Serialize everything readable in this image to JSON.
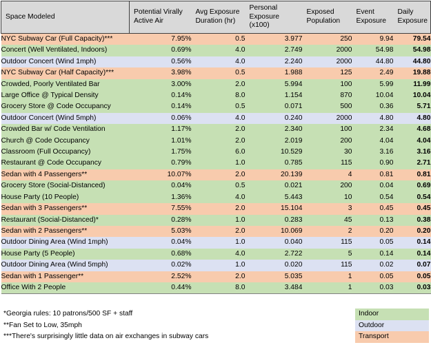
{
  "table": {
    "columns": [
      {
        "key": "space",
        "label": "Space Modeled"
      },
      {
        "key": "pva",
        "label": "Potential Virally Active Air"
      },
      {
        "key": "duration",
        "label": "Avg Exposure Duration (hr)"
      },
      {
        "key": "personal",
        "label": "Personal Exposure (x100)"
      },
      {
        "key": "exposed",
        "label": "Exposed Population"
      },
      {
        "key": "event",
        "label": "Event Exposure"
      },
      {
        "key": "daily",
        "label": "Daily Exposure"
      }
    ],
    "column_labels_multiline": {
      "space": [
        "Space Modeled"
      ],
      "pva": [
        "Potential Virally",
        "Active Air"
      ],
      "duration": [
        "Avg Exposure",
        "Duration (hr)"
      ],
      "personal": [
        "Personal",
        "Exposure",
        "(x100)"
      ],
      "exposed": [
        "Exposed",
        "Population"
      ],
      "event": [
        "Event",
        "Exposure"
      ],
      "daily": [
        "Daily",
        "Exposure"
      ]
    },
    "rows": [
      {
        "space": "NYC Subway Car (Full Capacity)***",
        "pva": "7.95%",
        "duration": "0.5",
        "personal": "3.977",
        "exposed": "250",
        "event": "9.94",
        "daily": "79.54",
        "category": "transport"
      },
      {
        "space": "Concert (Well Ventilated, Indoors)",
        "pva": "0.69%",
        "duration": "4.0",
        "personal": "2.749",
        "exposed": "2000",
        "event": "54.98",
        "daily": "54.98",
        "category": "indoor"
      },
      {
        "space": "Outdoor Concert (Wind 1mph)",
        "pva": "0.56%",
        "duration": "4.0",
        "personal": "2.240",
        "exposed": "2000",
        "event": "44.80",
        "daily": "44.80",
        "category": "outdoor"
      },
      {
        "space": "NYC Subway Car (Half Capacity)***",
        "pva": "3.98%",
        "duration": "0.5",
        "personal": "1.988",
        "exposed": "125",
        "event": "2.49",
        "daily": "19.88",
        "category": "transport"
      },
      {
        "space": "Crowded, Poorly Ventilated Bar",
        "pva": "3.00%",
        "duration": "2.0",
        "personal": "5.994",
        "exposed": "100",
        "event": "5.99",
        "daily": "11.99",
        "category": "indoor"
      },
      {
        "space": "Large Office @ Typical Density",
        "pva": "0.14%",
        "duration": "8.0",
        "personal": "1.154",
        "exposed": "870",
        "event": "10.04",
        "daily": "10.04",
        "category": "indoor"
      },
      {
        "space": "Grocery Store @ Code Occupancy",
        "pva": "0.14%",
        "duration": "0.5",
        "personal": "0.071",
        "exposed": "500",
        "event": "0.36",
        "daily": "5.71",
        "category": "indoor"
      },
      {
        "space": "Outdoor Concert (Wind 5mph)",
        "pva": "0.06%",
        "duration": "4.0",
        "personal": "0.240",
        "exposed": "2000",
        "event": "4.80",
        "daily": "4.80",
        "category": "outdoor"
      },
      {
        "space": "Crowded Bar w/ Code Ventilation",
        "pva": "1.17%",
        "duration": "2.0",
        "personal": "2.340",
        "exposed": "100",
        "event": "2.34",
        "daily": "4.68",
        "category": "indoor"
      },
      {
        "space": "Church @ Code Occupancy",
        "pva": "1.01%",
        "duration": "2.0",
        "personal": "2.019",
        "exposed": "200",
        "event": "4.04",
        "daily": "4.04",
        "category": "indoor"
      },
      {
        "space": "Classroom (Full Occupancy)",
        "pva": "1.75%",
        "duration": "6.0",
        "personal": "10.529",
        "exposed": "30",
        "event": "3.16",
        "daily": "3.16",
        "category": "indoor"
      },
      {
        "space": "Restaurant @ Code Occupancy",
        "pva": "0.79%",
        "duration": "1.0",
        "personal": "0.785",
        "exposed": "115",
        "event": "0.90",
        "daily": "2.71",
        "category": "indoor"
      },
      {
        "space": "Sedan with 4 Passengers**",
        "pva": "10.07%",
        "duration": "2.0",
        "personal": "20.139",
        "exposed": "4",
        "event": "0.81",
        "daily": "0.81",
        "category": "transport"
      },
      {
        "space": "Grocery Store (Social-Distanced)",
        "pva": "0.04%",
        "duration": "0.5",
        "personal": "0.021",
        "exposed": "200",
        "event": "0.04",
        "daily": "0.69",
        "category": "indoor"
      },
      {
        "space": "House Party (10 People)",
        "pva": "1.36%",
        "duration": "4.0",
        "personal": "5.443",
        "exposed": "10",
        "event": "0.54",
        "daily": "0.54",
        "category": "indoor"
      },
      {
        "space": "Sedan with 3 Passengers**",
        "pva": "7.55%",
        "duration": "2.0",
        "personal": "15.104",
        "exposed": "3",
        "event": "0.45",
        "daily": "0.45",
        "category": "transport"
      },
      {
        "space": "Restaurant (Social-Distanced)*",
        "pva": "0.28%",
        "duration": "1.0",
        "personal": "0.283",
        "exposed": "45",
        "event": "0.13",
        "daily": "0.38",
        "category": "indoor"
      },
      {
        "space": "Sedan with 2 Passengers**",
        "pva": "5.03%",
        "duration": "2.0",
        "personal": "10.069",
        "exposed": "2",
        "event": "0.20",
        "daily": "0.20",
        "category": "transport"
      },
      {
        "space": "Outdoor Dining Area (Wind 1mph)",
        "pva": "0.04%",
        "duration": "1.0",
        "personal": "0.040",
        "exposed": "115",
        "event": "0.05",
        "daily": "0.14",
        "category": "outdoor"
      },
      {
        "space": "House Party (5 People)",
        "pva": "0.68%",
        "duration": "4.0",
        "personal": "2.722",
        "exposed": "5",
        "event": "0.14",
        "daily": "0.14",
        "category": "indoor"
      },
      {
        "space": "Outdoor Dining Area (Wind 5mph)",
        "pva": "0.02%",
        "duration": "1.0",
        "personal": "0.020",
        "exposed": "115",
        "event": "0.02",
        "daily": "0.07",
        "category": "outdoor"
      },
      {
        "space": "Sedan with 1 Passenger**",
        "pva": "2.52%",
        "duration": "2.0",
        "personal": "5.035",
        "exposed": "1",
        "event": "0.05",
        "daily": "0.05",
        "category": "transport"
      },
      {
        "space": "Office With 2 People",
        "pva": "0.44%",
        "duration": "8.0",
        "personal": "3.484",
        "exposed": "1",
        "event": "0.03",
        "daily": "0.03",
        "category": "indoor"
      }
    ]
  },
  "footnotes": [
    "*Georgia rules: 10 patrons/500 SF + staff",
    "**Fan Set to Low, 35mph",
    "***There's surprisingly little data on air exchanges in subway cars"
  ],
  "legend": [
    {
      "label": "Indoor",
      "color": "#c6e0b4",
      "category": "indoor"
    },
    {
      "label": "Outdoor",
      "color": "#dce1f2",
      "category": "outdoor"
    },
    {
      "label": "Transport",
      "color": "#f8cbad",
      "category": "transport"
    }
  ],
  "chart_data": {
    "type": "table",
    "title": "Space Modeled exposure comparison",
    "columns": [
      "Space Modeled",
      "Potential Virally Active Air",
      "Avg Exposure Duration (hr)",
      "Personal Exposure (x100)",
      "Exposed Population",
      "Event Exposure",
      "Daily Exposure"
    ],
    "rows": [
      [
        "NYC Subway Car (Full Capacity)***",
        "7.95%",
        0.5,
        3.977,
        250,
        9.94,
        79.54
      ],
      [
        "Concert (Well Ventilated, Indoors)",
        "0.69%",
        4.0,
        2.749,
        2000,
        54.98,
        54.98
      ],
      [
        "Outdoor Concert (Wind 1mph)",
        "0.56%",
        4.0,
        2.24,
        2000,
        44.8,
        44.8
      ],
      [
        "NYC Subway Car (Half Capacity)***",
        "3.98%",
        0.5,
        1.988,
        125,
        2.49,
        19.88
      ],
      [
        "Crowded, Poorly Ventilated Bar",
        "3.00%",
        2.0,
        5.994,
        100,
        5.99,
        11.99
      ],
      [
        "Large Office @ Typical Density",
        "0.14%",
        8.0,
        1.154,
        870,
        10.04,
        10.04
      ],
      [
        "Grocery Store @ Code Occupancy",
        "0.14%",
        0.5,
        0.071,
        500,
        0.36,
        5.71
      ],
      [
        "Outdoor Concert (Wind 5mph)",
        "0.06%",
        4.0,
        0.24,
        2000,
        4.8,
        4.8
      ],
      [
        "Crowded Bar w/ Code Ventilation",
        "1.17%",
        2.0,
        2.34,
        100,
        2.34,
        4.68
      ],
      [
        "Church @ Code Occupancy",
        "1.01%",
        2.0,
        2.019,
        200,
        4.04,
        4.04
      ],
      [
        "Classroom (Full Occupancy)",
        "1.75%",
        6.0,
        10.529,
        30,
        3.16,
        3.16
      ],
      [
        "Restaurant @ Code Occupancy",
        "0.79%",
        1.0,
        0.785,
        115,
        0.9,
        2.71
      ],
      [
        "Sedan with 4 Passengers**",
        "10.07%",
        2.0,
        20.139,
        4,
        0.81,
        0.81
      ],
      [
        "Grocery Store (Social-Distanced)",
        "0.04%",
        0.5,
        0.021,
        200,
        0.04,
        0.69
      ],
      [
        "House Party (10 People)",
        "1.36%",
        4.0,
        5.443,
        10,
        0.54,
        0.54
      ],
      [
        "Sedan with 3 Passengers**",
        "7.55%",
        2.0,
        15.104,
        3,
        0.45,
        0.45
      ],
      [
        "Restaurant (Social-Distanced)*",
        "0.28%",
        1.0,
        0.283,
        45,
        0.13,
        0.38
      ],
      [
        "Sedan with 2 Passengers**",
        "5.03%",
        2.0,
        10.069,
        2,
        0.2,
        0.2
      ],
      [
        "Outdoor Dining Area (Wind 1mph)",
        "0.04%",
        1.0,
        0.04,
        115,
        0.05,
        0.14
      ],
      [
        "House Party (5 People)",
        "0.68%",
        4.0,
        2.722,
        5,
        0.14,
        0.14
      ],
      [
        "Outdoor Dining Area (Wind 5mph)",
        "0.02%",
        1.0,
        0.02,
        115,
        0.02,
        0.07
      ],
      [
        "Sedan with 1 Passenger**",
        "2.52%",
        2.0,
        5.035,
        1,
        0.05,
        0.05
      ],
      [
        "Office With 2 People",
        "0.44%",
        8.0,
        3.484,
        1,
        0.03,
        0.03
      ]
    ]
  }
}
